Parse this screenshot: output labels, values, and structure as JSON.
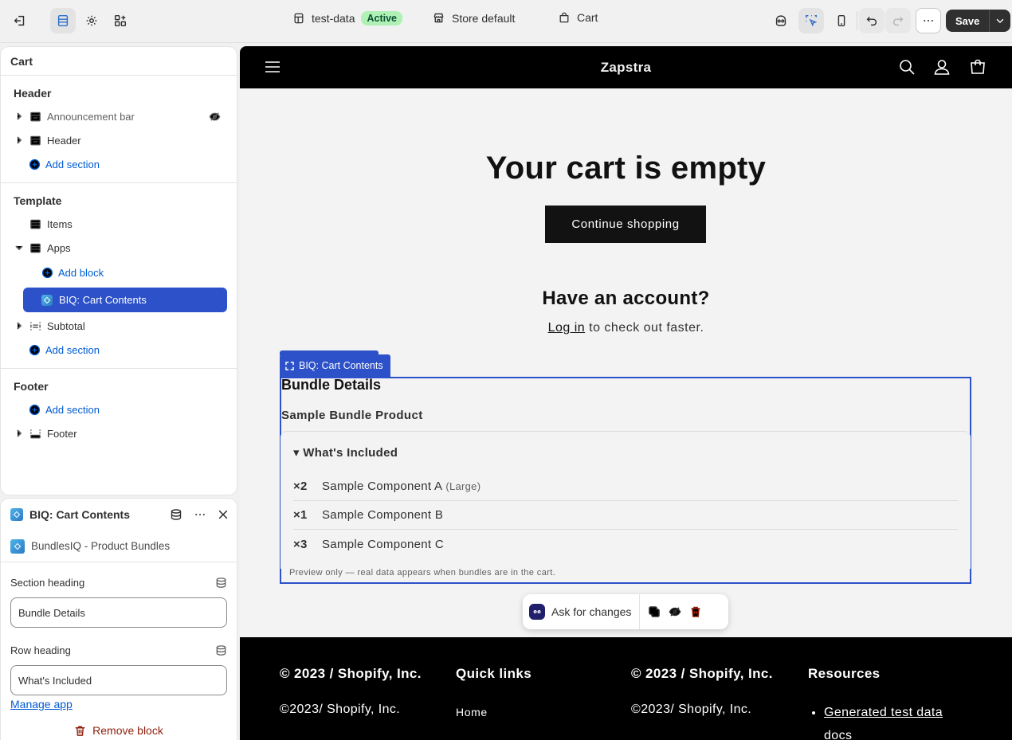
{
  "topbar": {
    "theme_name": "test-data",
    "theme_status": "Active",
    "store_label": "Store default",
    "page_label": "Cart",
    "save_label": "Save"
  },
  "sidebar": {
    "title": "Cart",
    "header_group": {
      "title": "Header",
      "items": [
        "Announcement bar",
        "Header"
      ],
      "add_label": "Add section"
    },
    "template_group": {
      "title": "Template",
      "items": [
        "Items",
        "Apps"
      ],
      "add_block_label": "Add block",
      "selected_block": "BIQ: Cart Contents",
      "subtotal": "Subtotal",
      "add_label": "Add section"
    },
    "footer_group": {
      "title": "Footer",
      "add_label": "Add section",
      "items": [
        "Footer"
      ]
    }
  },
  "settings": {
    "title": "BIQ: Cart Contents",
    "app_name": "BundlesIQ - Product Bundles",
    "section_heading_label": "Section heading",
    "section_heading_value": "Bundle Details",
    "row_heading_label": "Row heading",
    "row_heading_value": "What's Included",
    "manage_label": "Manage app",
    "remove_label": "Remove block"
  },
  "preview": {
    "store_name": "Zapstra",
    "empty_title": "Your cart is empty",
    "continue_label": "Continue shopping",
    "account_title": "Have an account?",
    "login_link": "Log in",
    "login_rest": " to check out faster.",
    "block_tab": "BIQ: Cart Contents",
    "bundle": {
      "title": "Bundle Details",
      "product": "Sample Bundle Product",
      "included_label": "▾ What's Included",
      "components": [
        {
          "qty": "×2",
          "name": "Sample Component A",
          "option": "(Large)"
        },
        {
          "qty": "×1",
          "name": "Sample Component B",
          "option": ""
        },
        {
          "qty": "×3",
          "name": "Sample Component C",
          "option": ""
        }
      ],
      "note": "Preview only — real data appears when bundles are in the cart."
    },
    "ask_label": "Ask for changes",
    "footer": {
      "col1_head": "© 2023 / Shopify, Inc.",
      "col1_text": "©2023/ Shopify, Inc.",
      "col2_head": "Quick links",
      "col2_link": "Home",
      "col3_head": "© 2023 / Shopify, Inc.",
      "col3_text": "©2023/ Shopify, Inc.",
      "col4_head": "Resources",
      "col4_link": "Generated test data docs"
    }
  },
  "colors": {
    "accent": "#2c51c8",
    "link": "#005bd3",
    "danger": "#8e1f0b",
    "active_badge": "#aff0b5"
  }
}
